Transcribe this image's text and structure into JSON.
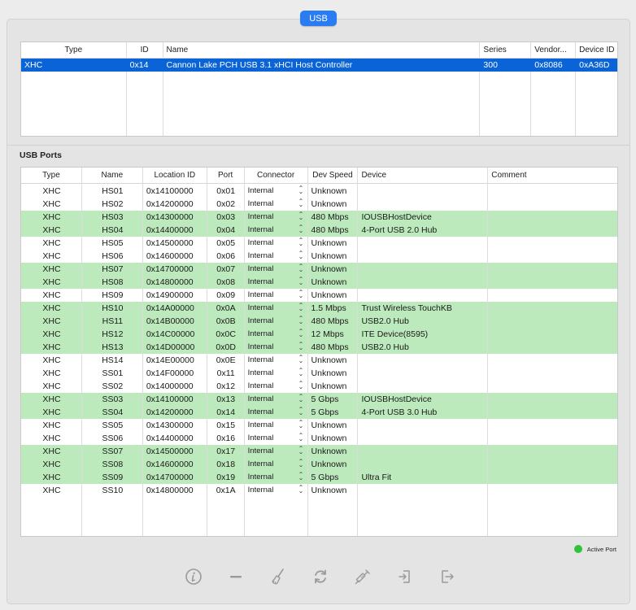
{
  "tab": {
    "label": "USB"
  },
  "controllers": {
    "headers": [
      "Type",
      "ID",
      "Name",
      "Series",
      "Vendor...",
      "Device ID"
    ],
    "rows": [
      {
        "type": "XHC",
        "id": "0x14",
        "name": "Cannon Lake PCH USB 3.1 xHCI Host Controller",
        "series": "300",
        "vendor": "0x8086",
        "device": "0xA36D"
      }
    ]
  },
  "ports_section": {
    "title": "USB Ports"
  },
  "ports": {
    "headers": [
      "Type",
      "Name",
      "Location ID",
      "Port",
      "Connector",
      "Dev Speed",
      "Device",
      "Comment"
    ],
    "rows": [
      {
        "type": "XHC",
        "name": "HS01",
        "loc": "0x14100000",
        "port": "0x01",
        "conn": "Internal",
        "speed": "Unknown",
        "device": "",
        "comment": "",
        "active": false
      },
      {
        "type": "XHC",
        "name": "HS02",
        "loc": "0x14200000",
        "port": "0x02",
        "conn": "Internal",
        "speed": "Unknown",
        "device": "",
        "comment": "",
        "active": false
      },
      {
        "type": "XHC",
        "name": "HS03",
        "loc": "0x14300000",
        "port": "0x03",
        "conn": "Internal",
        "speed": "480 Mbps",
        "device": "IOUSBHostDevice",
        "comment": "",
        "active": true
      },
      {
        "type": "XHC",
        "name": "HS04",
        "loc": "0x14400000",
        "port": "0x04",
        "conn": "Internal",
        "speed": "480 Mbps",
        "device": "4-Port USB 2.0 Hub",
        "comment": "",
        "active": true
      },
      {
        "type": "XHC",
        "name": "HS05",
        "loc": "0x14500000",
        "port": "0x05",
        "conn": "Internal",
        "speed": "Unknown",
        "device": "",
        "comment": "",
        "active": false
      },
      {
        "type": "XHC",
        "name": "HS06",
        "loc": "0x14600000",
        "port": "0x06",
        "conn": "Internal",
        "speed": "Unknown",
        "device": "",
        "comment": "",
        "active": false
      },
      {
        "type": "XHC",
        "name": "HS07",
        "loc": "0x14700000",
        "port": "0x07",
        "conn": "Internal",
        "speed": "Unknown",
        "device": "",
        "comment": "",
        "active": true
      },
      {
        "type": "XHC",
        "name": "HS08",
        "loc": "0x14800000",
        "port": "0x08",
        "conn": "Internal",
        "speed": "Unknown",
        "device": "",
        "comment": "",
        "active": true
      },
      {
        "type": "XHC",
        "name": "HS09",
        "loc": "0x14900000",
        "port": "0x09",
        "conn": "Internal",
        "speed": "Unknown",
        "device": "",
        "comment": "",
        "active": false
      },
      {
        "type": "XHC",
        "name": "HS10",
        "loc": "0x14A00000",
        "port": "0x0A",
        "conn": "Internal",
        "speed": "1.5 Mbps",
        "device": "Trust Wireless TouchKB",
        "comment": "",
        "active": true
      },
      {
        "type": "XHC",
        "name": "HS11",
        "loc": "0x14B00000",
        "port": "0x0B",
        "conn": "Internal",
        "speed": "480 Mbps",
        "device": "USB2.0 Hub",
        "comment": "",
        "active": true
      },
      {
        "type": "XHC",
        "name": "HS12",
        "loc": "0x14C00000",
        "port": "0x0C",
        "conn": "Internal",
        "speed": "12 Mbps",
        "device": "ITE Device(8595)",
        "comment": "",
        "active": true
      },
      {
        "type": "XHC",
        "name": "HS13",
        "loc": "0x14D00000",
        "port": "0x0D",
        "conn": "Internal",
        "speed": "480 Mbps",
        "device": "USB2.0 Hub",
        "comment": "",
        "active": true
      },
      {
        "type": "XHC",
        "name": "HS14",
        "loc": "0x14E00000",
        "port": "0x0E",
        "conn": "Internal",
        "speed": "Unknown",
        "device": "",
        "comment": "",
        "active": false
      },
      {
        "type": "XHC",
        "name": "SS01",
        "loc": "0x14F00000",
        "port": "0x11",
        "conn": "Internal",
        "speed": "Unknown",
        "device": "",
        "comment": "",
        "active": false
      },
      {
        "type": "XHC",
        "name": "SS02",
        "loc": "0x14000000",
        "port": "0x12",
        "conn": "Internal",
        "speed": "Unknown",
        "device": "",
        "comment": "",
        "active": false
      },
      {
        "type": "XHC",
        "name": "SS03",
        "loc": "0x14100000",
        "port": "0x13",
        "conn": "Internal",
        "speed": "5 Gbps",
        "device": "IOUSBHostDevice",
        "comment": "",
        "active": true
      },
      {
        "type": "XHC",
        "name": "SS04",
        "loc": "0x14200000",
        "port": "0x14",
        "conn": "Internal",
        "speed": "5 Gbps",
        "device": "4-Port USB 3.0 Hub",
        "comment": "",
        "active": true
      },
      {
        "type": "XHC",
        "name": "SS05",
        "loc": "0x14300000",
        "port": "0x15",
        "conn": "Internal",
        "speed": "Unknown",
        "device": "",
        "comment": "",
        "active": false
      },
      {
        "type": "XHC",
        "name": "SS06",
        "loc": "0x14400000",
        "port": "0x16",
        "conn": "Internal",
        "speed": "Unknown",
        "device": "",
        "comment": "",
        "active": false
      },
      {
        "type": "XHC",
        "name": "SS07",
        "loc": "0x14500000",
        "port": "0x17",
        "conn": "Internal",
        "speed": "Unknown",
        "device": "",
        "comment": "",
        "active": true
      },
      {
        "type": "XHC",
        "name": "SS08",
        "loc": "0x14600000",
        "port": "0x18",
        "conn": "Internal",
        "speed": "Unknown",
        "device": "",
        "comment": "",
        "active": true
      },
      {
        "type": "XHC",
        "name": "SS09",
        "loc": "0x14700000",
        "port": "0x19",
        "conn": "Internal",
        "speed": "5 Gbps",
        "device": "Ultra Fit",
        "comment": "",
        "active": true
      },
      {
        "type": "XHC",
        "name": "SS10",
        "loc": "0x14800000",
        "port": "0x1A",
        "conn": "Internal",
        "speed": "Unknown",
        "device": "",
        "comment": "",
        "active": false
      }
    ]
  },
  "legend": {
    "label": "Active Port",
    "color": "#2fc43a"
  },
  "colors": {
    "active_row": "#bdeabd",
    "selected_row": "#0a64d8",
    "accent": "#2a7cf2"
  },
  "toolbar": [
    {
      "name": "info-button",
      "icon": "info-icon"
    },
    {
      "name": "remove-button",
      "icon": "minus-icon"
    },
    {
      "name": "clear-button",
      "icon": "broom-icon"
    },
    {
      "name": "refresh-button",
      "icon": "refresh-icon"
    },
    {
      "name": "inject-button",
      "icon": "syringe-icon"
    },
    {
      "name": "import-button",
      "icon": "import-icon"
    },
    {
      "name": "export-button",
      "icon": "export-icon"
    }
  ]
}
